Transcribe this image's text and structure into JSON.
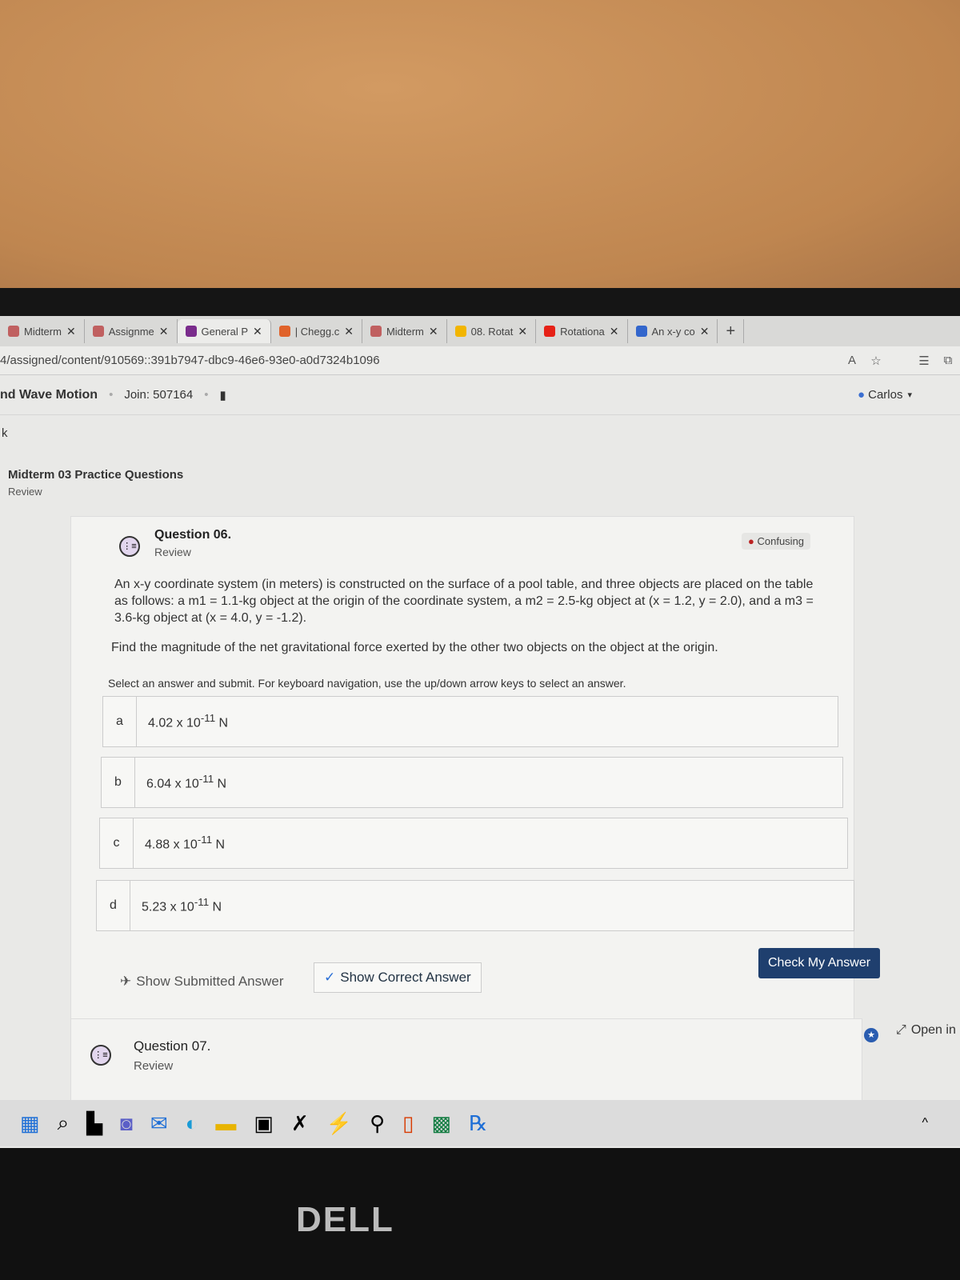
{
  "browser": {
    "tabs": [
      {
        "label": "Midterm",
        "icon": "document-icon",
        "color": "#c06060"
      },
      {
        "label": "Assignme",
        "icon": "document-icon",
        "color": "#c06060"
      },
      {
        "label": "General P",
        "icon": "t-logo-icon",
        "color": "#7a2c8c",
        "active": true
      },
      {
        "label": "| Chegg.c",
        "icon": "chegg-icon",
        "color": "#e0622a"
      },
      {
        "label": "Midterm",
        "icon": "document-icon",
        "color": "#c06060"
      },
      {
        "label": "08. Rotat",
        "icon": "slides-icon",
        "color": "#f2b500"
      },
      {
        "label": "Rotationa",
        "icon": "youtube-icon",
        "color": "#e62117"
      },
      {
        "label": "An x-y co",
        "icon": "search-icon",
        "color": "#3366cc"
      }
    ],
    "new_tab": "+",
    "url": "4/assigned/content/910569::391b7947-dbc9-46e6-93e0-a0d7324b1096"
  },
  "header": {
    "course": "nd Wave Motion",
    "join": "Join: 507164",
    "user": "Carlos",
    "back": "k"
  },
  "assignment": {
    "title": "Midterm 03 Practice Questions",
    "subtitle": "Review"
  },
  "question": {
    "number": "Question 06.",
    "status": "Review",
    "badge": "Confusing",
    "text": "An x-y coordinate system (in meters) is constructed on the surface of a pool table, and three objects are placed on the table as follows: a m1 = 1.1-kg object at the origin of the coordinate system, a m2 = 2.5-kg object at (x = 1.2, y = 2.0), and a m3 = 3.6-kg object at (x = 4.0, y = -1.2).",
    "prompt": "Find the magnitude of the net gravitational force exerted by the other two objects on the object at the origin.",
    "instructions": "Select an answer and submit. For keyboard navigation, use the up/down arrow keys to select an answer.",
    "options": [
      {
        "letter": "a",
        "mantissa": "4.02 x 10",
        "exp": "-11",
        "unit": " N"
      },
      {
        "letter": "b",
        "mantissa": "6.04 x 10",
        "exp": "-11",
        "unit": " N"
      },
      {
        "letter": "c",
        "mantissa": "4.88 x 10",
        "exp": "-11",
        "unit": " N"
      },
      {
        "letter": "d",
        "mantissa": "5.23 x 10",
        "exp": "-11",
        "unit": " N"
      }
    ],
    "show_submitted": "Show Submitted Answer",
    "show_correct": "Show Correct Answer",
    "check": "Check My Answer",
    "open_in": "Open in"
  },
  "next_question": {
    "number": "Question 07.",
    "status": "Review"
  },
  "brand": "DELL"
}
